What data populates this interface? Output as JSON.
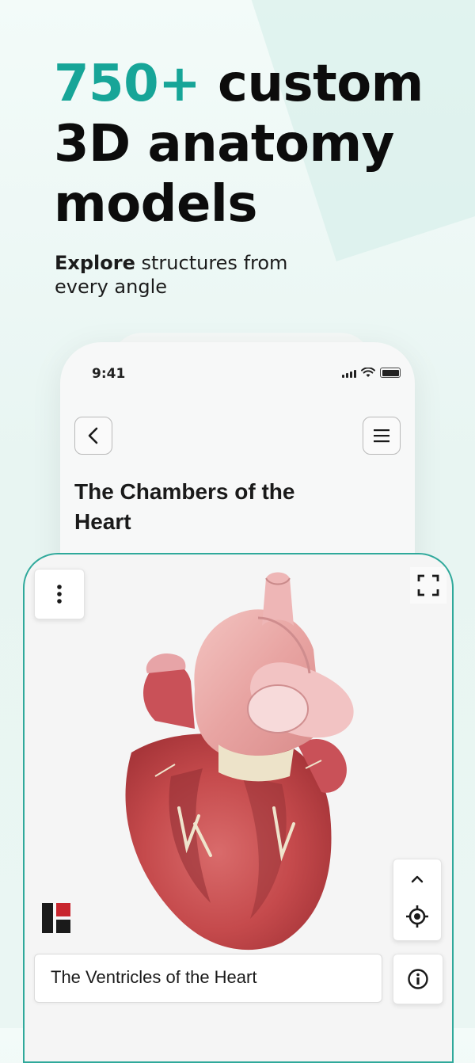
{
  "hero": {
    "headline_accent": "750+",
    "headline_rest_line1": " custom",
    "headline_line2": "3D anatomy",
    "headline_line3": "models",
    "sub_bold": "Explore",
    "sub_rest": " structures from every angle"
  },
  "phone": {
    "status_time": "9:41",
    "back_icon": "chevron-left-icon",
    "menu_icon": "hamburger-menu-icon",
    "page_title": "The Chambers of the Heart"
  },
  "viewer": {
    "more_icon": "vertical-dots-icon",
    "fullscreen_icon": "fullscreen-icon",
    "collapse_icon": "chevron-up-icon",
    "recenter_icon": "crosshair-icon",
    "info_icon": "info-icon",
    "model_label": "The Ventricles of the Heart",
    "accent_color": "#2fa99b"
  }
}
